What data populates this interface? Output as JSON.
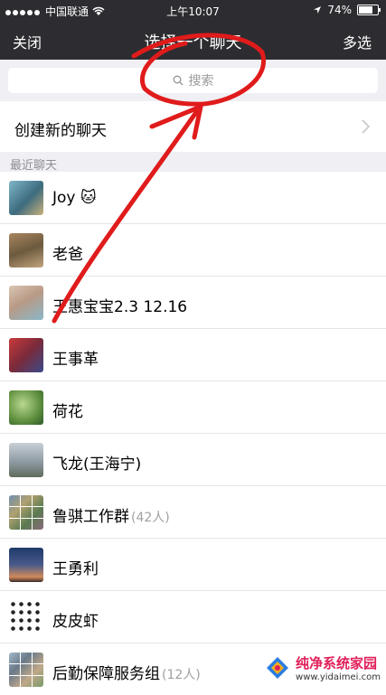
{
  "status": {
    "carrier": "中国联通",
    "time": "上午10:07",
    "battery": "74%",
    "battery_level": 0.74
  },
  "nav": {
    "close": "关闭",
    "title": "选择一个聊天",
    "multi": "多选"
  },
  "search": {
    "placeholder": "搜索"
  },
  "new_chat": {
    "label": "创建新的聊天"
  },
  "section_label": "最近聊天",
  "contacts": [
    {
      "name": "Joy 🐱",
      "count": ""
    },
    {
      "name": "老爸",
      "count": ""
    },
    {
      "name": "王惠宝宝2.3 12.16",
      "count": ""
    },
    {
      "name": "王事革",
      "count": ""
    },
    {
      "name": "荷花",
      "count": ""
    },
    {
      "name": "飞龙(王海宁)",
      "count": ""
    },
    {
      "name": "鲁骐工作群",
      "count": "(42人)"
    },
    {
      "name": "王勇利",
      "count": ""
    },
    {
      "name": "皮皮虾",
      "count": ""
    },
    {
      "name": "后勤保障服务组",
      "count": "(12人)"
    }
  ],
  "watermark": {
    "line1": "纯净系统家园",
    "line2": "www.yidaimei.com"
  },
  "colors": {
    "header": "#2d2d31",
    "annotation": "#e01b1b",
    "background": "#efeff4"
  }
}
